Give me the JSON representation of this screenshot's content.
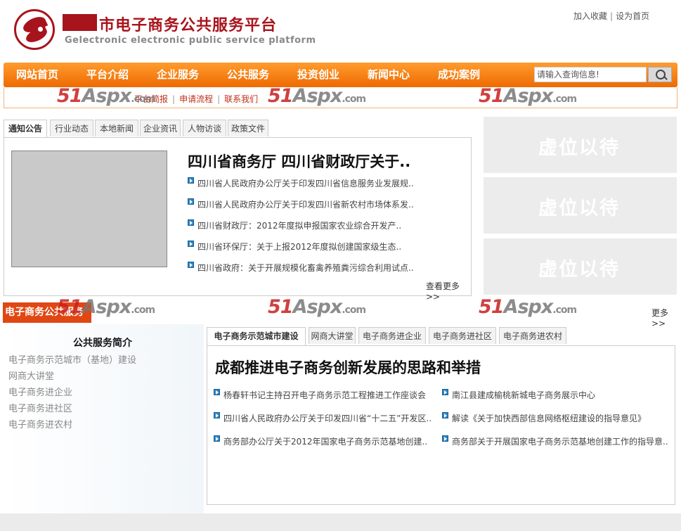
{
  "header": {
    "title": "市电子商务公共服务平台",
    "subtitle": "Gelectronic  electronic public service platform",
    "links": [
      "加入收藏",
      "设为首页"
    ]
  },
  "nav": {
    "items": [
      "网站首页",
      "平台介绍",
      "企业服务",
      "公共服务",
      "投资创业",
      "新闻中心",
      "成功案例"
    ],
    "search_placeholder": "请输入查询信息!"
  },
  "subnav": {
    "links": [
      "平台简报",
      "申请流程",
      "联系我们"
    ]
  },
  "watermark": {
    "brand": "51",
    "aspx": "Aspx",
    "com": ".com"
  },
  "news": {
    "tabs": [
      "通知公告",
      "行业动态",
      "本地新闻",
      "企业资讯",
      "人物访谈",
      "政策文件"
    ],
    "headline": "四川省商务厅  四川省财政厅关于..",
    "items": [
      "四川省人民政府办公厅关于印发四川省信息服务业发展规..",
      "四川省人民政府办公厅关于印发四川省新农村市场体系发..",
      "四川省财政厅：2012年度拟申报国家农业综合开发产..",
      "四川省环保厅：关于上报2012年度拟创建国家级生态..",
      "四川省政府：关于开展规模化畜禽养殖粪污综合利用试点.."
    ],
    "more": "查看更多>>"
  },
  "placeholders": [
    "虚位以待",
    "虚位以待",
    "虚位以待"
  ],
  "ecommerce": {
    "section_title": "电子商务公共服务",
    "more": "更多>>",
    "sidebar_title": "公共服务简介",
    "sidebar_items": [
      "电子商务示范城市（基地）建设",
      "网商大讲堂",
      "电子商务进企业",
      "电子商务进社区",
      "电子商务进农村"
    ],
    "tabs": [
      "电子商务示范城市建设",
      "网商大讲堂",
      "电子商务进企业",
      "电子商务进社区",
      "电子商务进农村"
    ],
    "headline": "成都推进电子商务创新发展的思路和举措",
    "items": [
      "杨春轩书记主持召开电子商务示范工程推进工作座谈会",
      "南江县建成榆桃新城电子商务展示中心",
      "四川省人民政府办公厅关于印发四川省“十二五”开发区..",
      "解读《关于加快西部信息网络枢纽建设的指导意见》",
      "商务部办公厅关于2012年国家电子商务示范基地创建..",
      "商务部关于开展国家电子商务示范基地创建工作的指导意.."
    ]
  },
  "colors": {
    "brand_red": "#a8141c",
    "nav_orange": "#f07a0a",
    "section_red": "#e04713"
  }
}
